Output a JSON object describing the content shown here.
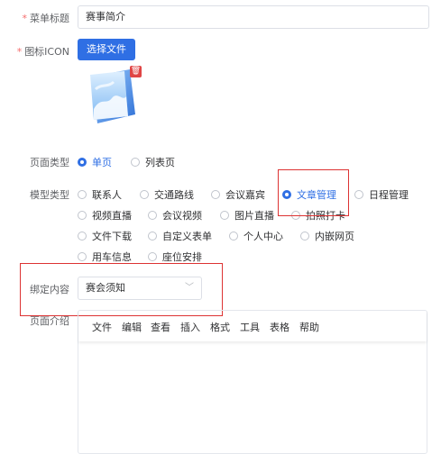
{
  "form": {
    "menu_title": {
      "label": "菜单标题",
      "value": "赛事简介",
      "required": "*"
    },
    "icon": {
      "label": "图标ICON",
      "button": "选择文件",
      "required": "*"
    },
    "page_type": {
      "label": "页面类型",
      "options": [
        "单页",
        "列表页"
      ],
      "selected": "单页"
    },
    "model_type": {
      "label": "模型类型",
      "options": [
        "联系人",
        "交通路线",
        "会议嘉宾",
        "文章管理",
        "日程管理",
        "视频直播",
        "会议视频",
        "图片直播",
        "拍照打卡",
        "文件下载",
        "自定义表单",
        "个人中心",
        "内嵌网页",
        "用车信息",
        "座位安排"
      ],
      "selected": "文章管理"
    },
    "bind_content": {
      "label": "绑定内容",
      "value": "赛会须知"
    },
    "page_intro": {
      "label": "页面介绍",
      "menus": [
        "文件",
        "编辑",
        "查看",
        "插入",
        "格式",
        "工具",
        "表格",
        "帮助"
      ]
    }
  },
  "colors": {
    "primary": "#2f6fe4",
    "required": "#f56c6c",
    "highlight": "#dd3333"
  }
}
